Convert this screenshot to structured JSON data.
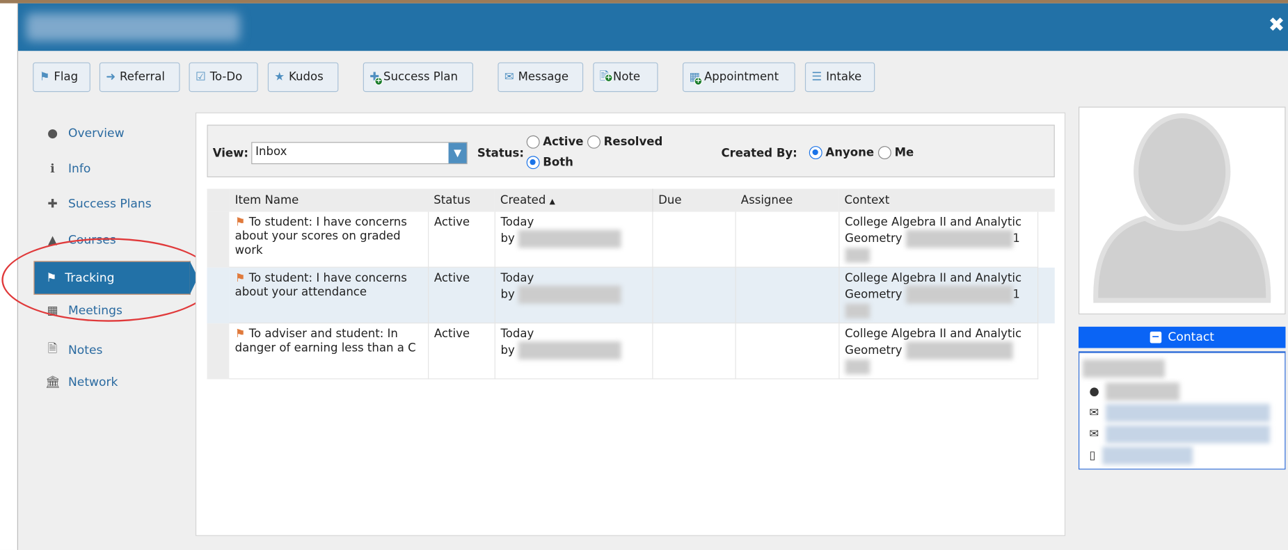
{
  "window": {
    "close_icon": "close-icon"
  },
  "toolbar": [
    {
      "label": "Flag",
      "icon": "⚑"
    },
    {
      "label": "Referral",
      "icon": "➜"
    },
    {
      "label": "To-Do",
      "icon": "☑"
    },
    {
      "label": "Kudos",
      "icon": "★"
    },
    {
      "label": "Success Plan",
      "icon": "✚"
    },
    {
      "label": "Message",
      "icon": "✉"
    },
    {
      "label": "Note",
      "icon": "🗎"
    },
    {
      "label": "Appointment",
      "icon": "▦"
    },
    {
      "label": "Intake",
      "icon": "☰"
    }
  ],
  "sidebar": {
    "items": [
      {
        "label": "Overview"
      },
      {
        "label": "Info"
      },
      {
        "label": "Success Plans"
      },
      {
        "label": "Courses"
      },
      {
        "label": "Tracking"
      },
      {
        "label": "Meetings"
      },
      {
        "label": "Notes"
      },
      {
        "label": "Network"
      }
    ]
  },
  "filter": {
    "view_label": "View:",
    "view_value": "Inbox",
    "status_label": "Status:",
    "status_options": [
      "Active",
      "Resolved",
      "Both"
    ],
    "status_selected": "Both",
    "created_by_label": "Created By:",
    "created_by_options": [
      "Anyone",
      "Me"
    ],
    "created_by_selected": "Anyone"
  },
  "table": {
    "headers": [
      "Item Name",
      "Status",
      "Created",
      "Due",
      "Assignee",
      "Context"
    ],
    "rows": [
      {
        "name": "To student: I have concerns about your scores on graded work",
        "status": "Active",
        "created": "Today",
        "by": "by",
        "due": "",
        "assignee": "",
        "context": "College Algebra II and Analytic Geometry",
        "ctx_tail": "1"
      },
      {
        "name": "To student: I have concerns about your attendance",
        "status": "Active",
        "created": "Today",
        "by": "by",
        "due": "",
        "assignee": "",
        "context": "College Algebra II and Analytic Geometry",
        "ctx_tail": "1"
      },
      {
        "name": "To adviser and student: In danger of earning less than a C",
        "status": "Active",
        "created": "Today",
        "by": "by",
        "due": "",
        "assignee": "",
        "context": "College Algebra II and Analytic Geometry",
        "ctx_tail": ""
      }
    ]
  },
  "contact": {
    "title": "Contact"
  },
  "colors": {
    "header": "#2271a7",
    "contact": "#0a64f5",
    "flag": "#e07a3c"
  }
}
